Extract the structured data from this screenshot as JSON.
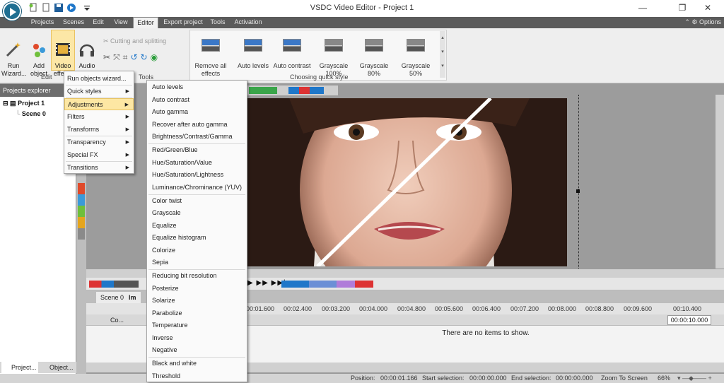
{
  "window": {
    "title": "VSDC Video Editor - Project 1",
    "options_label": "Options",
    "minimize": "—",
    "maximize": "❐",
    "close": "✕"
  },
  "menu_tabs": [
    "Projects",
    "Scenes",
    "Edit",
    "View",
    "Editor",
    "Export project",
    "Tools",
    "Activation"
  ],
  "active_tab": "Editor",
  "ribbon": {
    "run_wizard": "Run\nWizard...",
    "add_object": "Add\nobject",
    "video_effects": "Video\neffects",
    "audio_effects": "Audio\neffects",
    "cutting_splitting": "Cutting and splitting",
    "edit_group_partial": "Edit",
    "tools_group": "Tools",
    "quick_styles_group": "Choosing quick style",
    "quick_styles": [
      {
        "label": "Remove all\neffects",
        "gray": false
      },
      {
        "label": "Auto levels",
        "gray": false
      },
      {
        "label": "Auto contrast",
        "gray": false
      },
      {
        "label": "Grayscale\n100%",
        "gray": true
      },
      {
        "label": "Grayscale 80%",
        "gray": true
      },
      {
        "label": "Grayscale 50%",
        "gray": true
      }
    ]
  },
  "left_panel": {
    "header": "Projects explorer",
    "tree": [
      "Project 1",
      "Scene 0"
    ],
    "bottom_tabs": [
      "Project...",
      "Object..."
    ]
  },
  "main_menu": {
    "items": [
      {
        "label": "Run objects wizard...",
        "arrow": false
      },
      {
        "label": "Quick styles",
        "arrow": true
      },
      {
        "label": "Adjustments",
        "arrow": true,
        "selected": true
      },
      {
        "label": "Filters",
        "arrow": true
      },
      {
        "label": "Transforms",
        "arrow": true
      },
      {
        "label": "Transparency",
        "arrow": true
      },
      {
        "label": "Special FX",
        "arrow": true
      },
      {
        "label": "Transitions",
        "arrow": true
      }
    ]
  },
  "adjustments_menu": {
    "groups": [
      [
        "Auto levels",
        "Auto contrast",
        "Auto gamma",
        "Recover after auto gamma",
        "Brightness/Contrast/Gamma"
      ],
      [
        "Red/Green/Blue",
        "Hue/Saturation/Value",
        "Hue/Saturation/Lightness",
        "Luminance/Chrominance (YUV)"
      ],
      [
        "Color twist",
        "Grayscale",
        "Equalize",
        "Equalize histogram",
        "Colorize",
        "Sepia"
      ],
      [
        "Reducing bit resolution",
        "Posterize",
        "Solarize",
        "Parabolize",
        "Temperature",
        "Inverse",
        "Negative"
      ],
      [
        "Black and white",
        "Threshold"
      ]
    ]
  },
  "timeline": {
    "tabs": [
      "Scene 0",
      "Im"
    ],
    "col_header": "Co...",
    "ticks": [
      "00:01.600",
      "00:02.400",
      "00:03.200",
      "00:04.000",
      "00:04.800",
      "00:05.600",
      "00:06.400",
      "00:07.200",
      "00:08.000",
      "00:08.800",
      "00:09.600",
      "00:10.400"
    ],
    "duration": "00:00:10.000",
    "empty_message": "There are no items to show."
  },
  "status": {
    "position_label": "Position:",
    "position_value": "00:00:01.166",
    "start_label": "Start selection:",
    "start_value": "00:00:00.000",
    "end_label": "End selection:",
    "end_value": "00:00:00.000",
    "zoom_label": "Zoom To Screen",
    "zoom_value": "66%"
  }
}
